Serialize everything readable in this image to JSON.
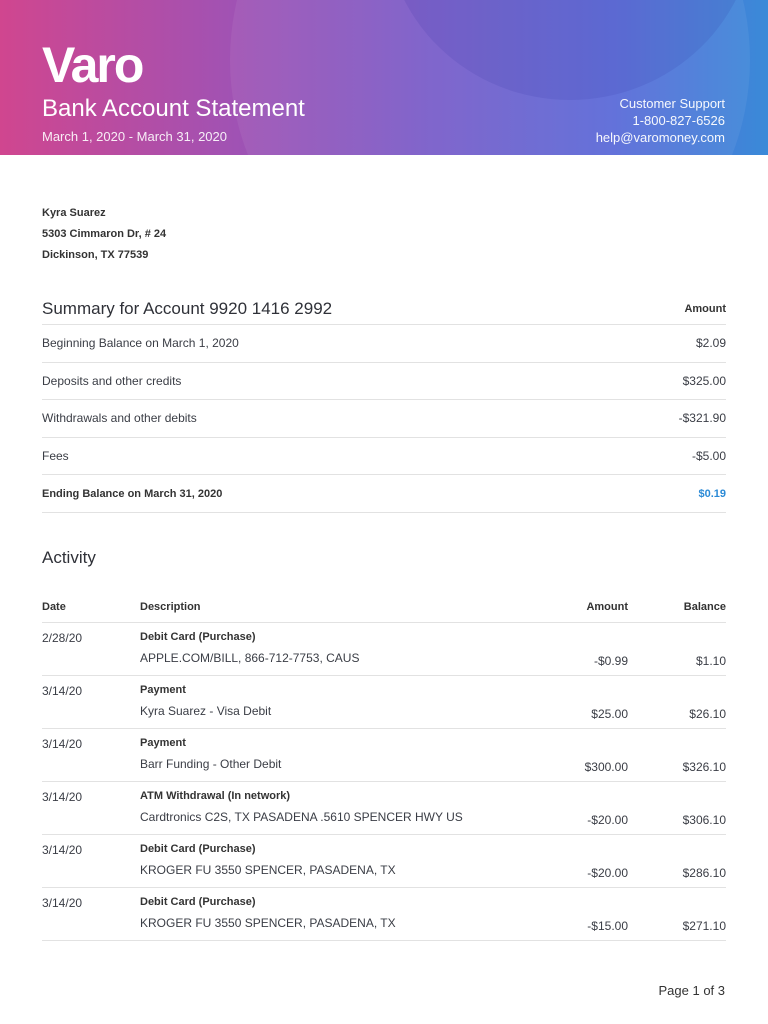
{
  "header": {
    "logo": "Varo",
    "title": "Bank Account Statement",
    "period": "March 1, 2020 - March 31, 2020",
    "support_label": "Customer Support",
    "phone": "1-800-827-6526",
    "email": "help@varomoney.com"
  },
  "customer": {
    "name": "Kyra Suarez",
    "address1": "5303 Cimmaron Dr, # 24",
    "address2": "Dickinson, TX 77539"
  },
  "summary": {
    "title": "Summary for Account 9920 1416 2992",
    "amount_header": "Amount",
    "rows": [
      {
        "label": "Beginning Balance on March 1, 2020",
        "value": "$2.09"
      },
      {
        "label": "Deposits and other credits",
        "value": "$325.00"
      },
      {
        "label": "Withdrawals and other debits",
        "value": "-$321.90"
      },
      {
        "label": "Fees",
        "value": "-$5.00"
      },
      {
        "label": "Ending Balance on March 31, 2020",
        "value": "$0.19"
      }
    ]
  },
  "activity": {
    "title": "Activity",
    "headers": {
      "date": "Date",
      "description": "Description",
      "amount": "Amount",
      "balance": "Balance"
    },
    "rows": [
      {
        "date": "2/28/20",
        "type": "Debit Card (Purchase)",
        "detail": "APPLE.COM/BILL, 866-712-7753, CAUS",
        "amount": "-$0.99",
        "balance": "$1.10"
      },
      {
        "date": "3/14/20",
        "type": "Payment",
        "detail": "Kyra Suarez - Visa Debit",
        "amount": "$25.00",
        "balance": "$26.10"
      },
      {
        "date": "3/14/20",
        "type": "Payment",
        "detail": "Barr Funding - Other Debit",
        "amount": "$300.00",
        "balance": "$326.10"
      },
      {
        "date": "3/14/20",
        "type": "ATM Withdrawal (In network)",
        "detail": "Cardtronics C2S, TX PASADENA .5610 SPENCER HWY US",
        "amount": "-$20.00",
        "balance": "$306.10"
      },
      {
        "date": "3/14/20",
        "type": "Debit Card (Purchase)",
        "detail": "KROGER FU 3550 SPENCER, PASADENA, TX",
        "amount": "-$20.00",
        "balance": "$286.10"
      },
      {
        "date": "3/14/20",
        "type": "Debit Card (Purchase)",
        "detail": "KROGER FU 3550 SPENCER, PASADENA, TX",
        "amount": "-$15.00",
        "balance": "$271.10"
      }
    ]
  },
  "footer": {
    "page": "Page 1 of 3"
  }
}
